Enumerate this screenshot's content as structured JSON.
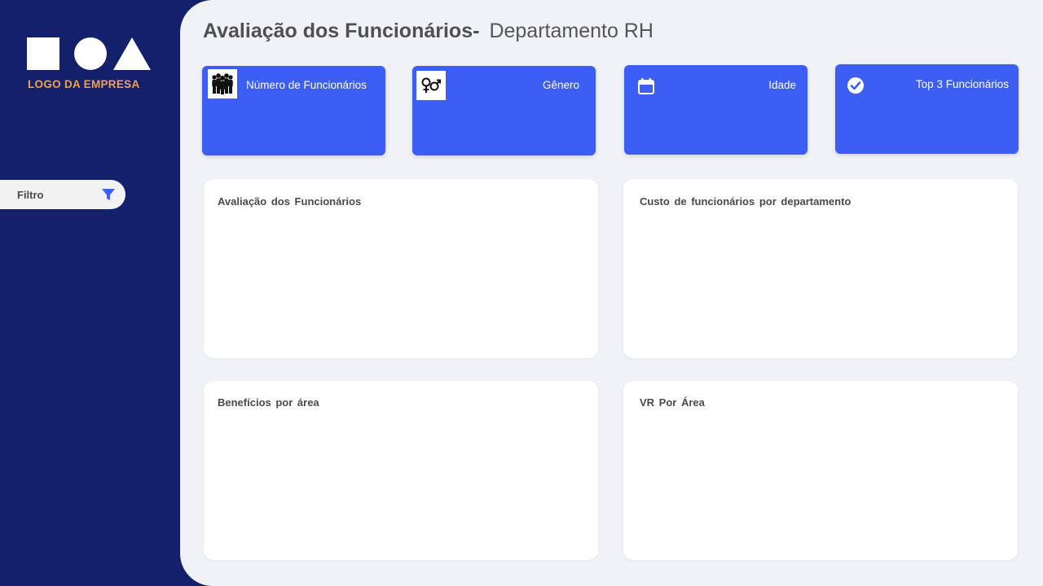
{
  "sidebar": {
    "logo_text": "LOGO DA EMPRESA",
    "filter_label": "Filtro"
  },
  "header": {
    "title_bold": "Avaliação dos Funcionários-",
    "title_light": "Departamento RH"
  },
  "kpis": [
    {
      "label": "Número de Funcionários",
      "icon": "people-group-icon"
    },
    {
      "label": "Gênero",
      "icon": "gender-icon"
    },
    {
      "label": "Idade",
      "icon": "calendar-icon"
    },
    {
      "label": "Top 3 Funcionários",
      "icon": "check-circle-icon"
    }
  ],
  "panels": [
    {
      "title": "Avaliação  dos Funcionários"
    },
    {
      "title": "Custo  de funcionários  por departamento"
    },
    {
      "title": "Benefícios  por área"
    },
    {
      "title": "VR Por Área"
    }
  ],
  "colors": {
    "sidebar_bg": "#13206b",
    "main_bg": "#f1f2f7",
    "kpi_bg": "#3d5ef5",
    "logo_text": "#f2a24a",
    "filter_icon": "#3d5ef5"
  }
}
